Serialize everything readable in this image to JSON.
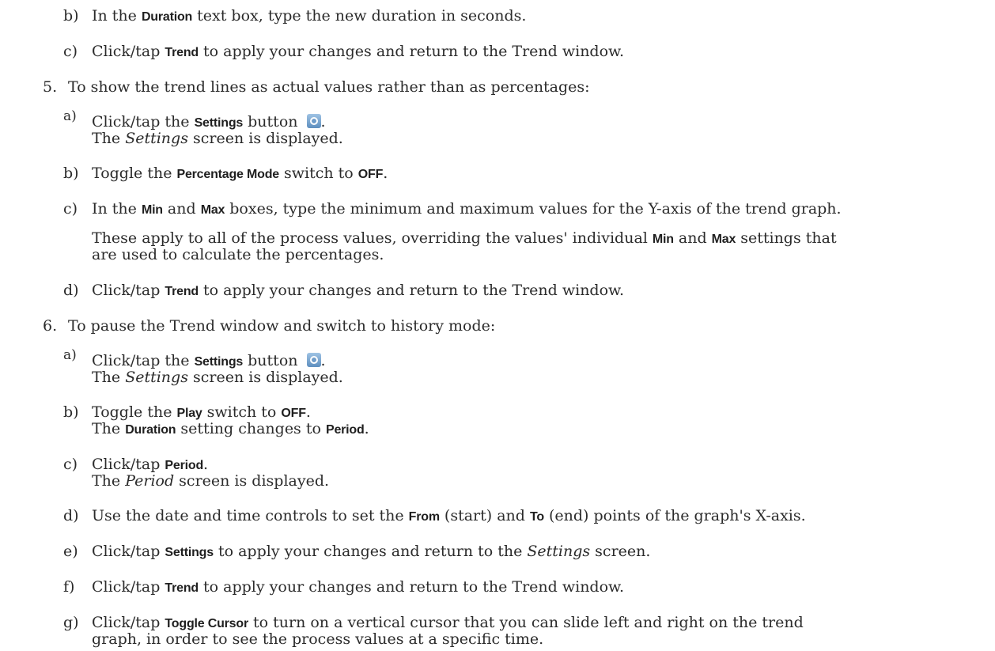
{
  "settings_icon": "settings-gear-icon",
  "step4": {
    "b": {
      "m": "b)",
      "t1": "In the ",
      "k1": "Duration",
      "t2": " text box, type the new duration in seconds."
    },
    "c": {
      "m": "c)",
      "t1": "Click/tap ",
      "k1": "Trend",
      "t2": " to apply your changes and return to the Trend window."
    }
  },
  "step5": {
    "m": "5.",
    "t": "To show the trend lines as actual values rather than as percentages:",
    "a": {
      "m": "a)",
      "t1": "Click/tap the ",
      "k1": "Settings",
      "t2": " button ",
      "t3": ".",
      "r1": "The ",
      "r2": "Settings",
      "r3": " screen is displayed."
    },
    "b": {
      "m": "b)",
      "t1": "Toggle the ",
      "k1": "Percentage Mode",
      "t2": " switch to ",
      "k2": "OFF",
      "t3": "."
    },
    "c": {
      "m": "c)",
      "t1": "In the ",
      "k1": "Min",
      "t2": " and ",
      "k2": "Max",
      "t3": " boxes, type the minimum and maximum values for the Y-axis of the trend graph.",
      "n1": "These apply to all of the process values, overriding the values' individual ",
      "nk1": "Min",
      "n2": " and ",
      "nk2": "Max",
      "n3": " settings that",
      "n4": "are used to calculate the percentages."
    },
    "d": {
      "m": "d)",
      "t1": "Click/tap ",
      "k1": "Trend",
      "t2": " to apply your changes and return to the Trend window."
    }
  },
  "step6": {
    "m": "6.",
    "t": "To pause the Trend window and switch to history mode:",
    "a": {
      "m": "a)",
      "t1": "Click/tap the ",
      "k1": "Settings",
      "t2": " button ",
      "t3": ".",
      "r1": "The ",
      "r2": "Settings",
      "r3": " screen is displayed."
    },
    "b": {
      "m": "b)",
      "t1": "Toggle the ",
      "k1": "Play",
      "t2": " switch to ",
      "k2": "OFF",
      "t3": ".",
      "r1": "The ",
      "rk1": "Duration",
      "r2": " setting changes to ",
      "rk2": "Period",
      "r3": "."
    },
    "c": {
      "m": "c)",
      "t1": "Click/tap ",
      "k1": "Period",
      "t2": ".",
      "r1": "The ",
      "r2": "Period",
      "r3": " screen is displayed."
    },
    "d": {
      "m": "d)",
      "t1": "Use the date and time controls to set the ",
      "k1": "From",
      "t2": " (start) and ",
      "k2": "To",
      "t3": " (end) points of the graph's X-axis."
    },
    "e": {
      "m": "e)",
      "t1": "Click/tap ",
      "k1": "Settings",
      "t2": " to apply your changes and return to the ",
      "i1": "Settings",
      "t3": " screen."
    },
    "f": {
      "m": "f)",
      "t1": "Click/tap ",
      "k1": "Trend",
      "t2": " to apply your changes and return to the Trend window."
    },
    "g": {
      "m": "g)",
      "t1": "Click/tap ",
      "k1": "Toggle Cursor",
      "t2": " to turn on a vertical cursor that you can slide left and right on the trend",
      "t3": "graph, in order to see the process values at a specific time."
    }
  }
}
